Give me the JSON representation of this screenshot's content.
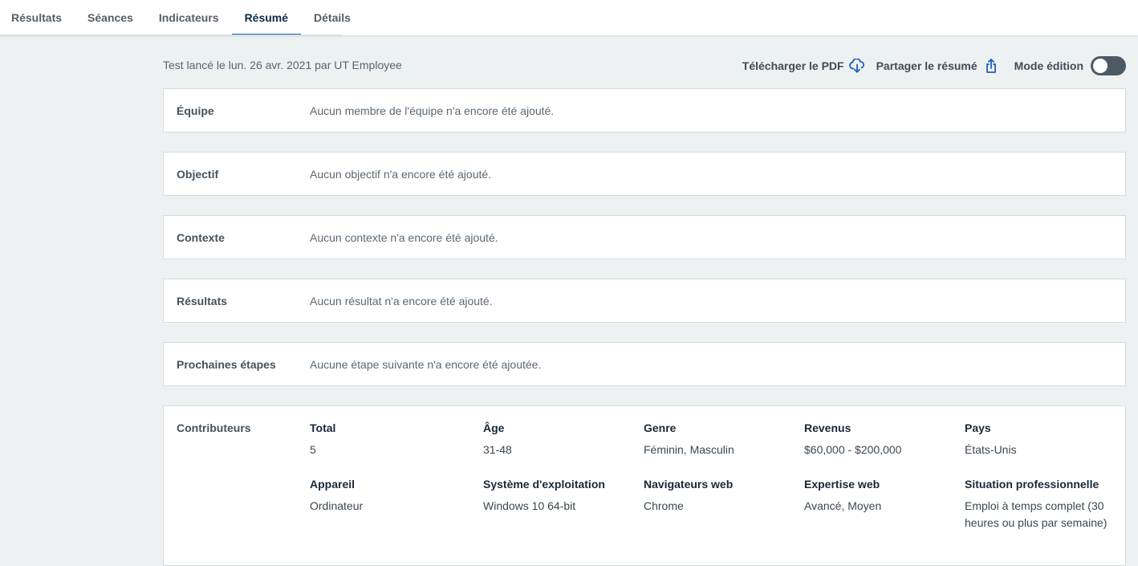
{
  "tabs": [
    {
      "label": "Résultats",
      "active": false
    },
    {
      "label": "Séances",
      "active": false
    },
    {
      "label": "Indicateurs",
      "active": false
    },
    {
      "label": "Résumé",
      "active": true
    },
    {
      "label": "Détails",
      "active": false
    }
  ],
  "subheader": {
    "launched_text": "Test lancé le lun. 26 avr. 2021 par UT Employee",
    "download_pdf_label": "Télécharger le PDF",
    "share_summary_label": "Partager le résumé",
    "edit_mode_label": "Mode édition",
    "edit_mode_on": false
  },
  "sections": [
    {
      "label": "Équipe",
      "text": "Aucun membre de l'équipe n'a encore été ajouté."
    },
    {
      "label": "Objectif",
      "text": "Aucun objectif n'a encore été ajouté."
    },
    {
      "label": "Contexte",
      "text": "Aucun contexte n'a encore été ajouté."
    },
    {
      "label": "Résultats",
      "text": "Aucun résultat n'a encore été ajouté."
    },
    {
      "label": "Prochaines étapes",
      "text": "Aucune étape suivante n'a encore été ajoutée."
    }
  ],
  "contributors": {
    "label": "Contributeurs",
    "row1": [
      {
        "title": "Total",
        "value": "5"
      },
      {
        "title": "Âge",
        "value": "31-48"
      },
      {
        "title": "Genre",
        "value": "Féminin, Masculin"
      },
      {
        "title": "Revenus",
        "value": "$60,000 - $200,000"
      },
      {
        "title": "Pays",
        "value": "États-Unis"
      }
    ],
    "row2": [
      {
        "title": "Appareil",
        "value": "Ordinateur"
      },
      {
        "title": "Système d'exploitation",
        "value": "Windows 10 64-bit"
      },
      {
        "title": "Navigateurs web",
        "value": "Chrome"
      },
      {
        "title": "Expertise web",
        "value": "Avancé, Moyen"
      },
      {
        "title": "Situation professionnelle",
        "value": "Emploi à temps complet (30 heures ou plus par semaine)"
      }
    ]
  },
  "colors": {
    "background": "#eef1f2",
    "accent": "#1d5fbf",
    "toggle_off": "#4d5963"
  },
  "icons": {
    "download": "cloud-download-icon",
    "share": "share-icon"
  }
}
